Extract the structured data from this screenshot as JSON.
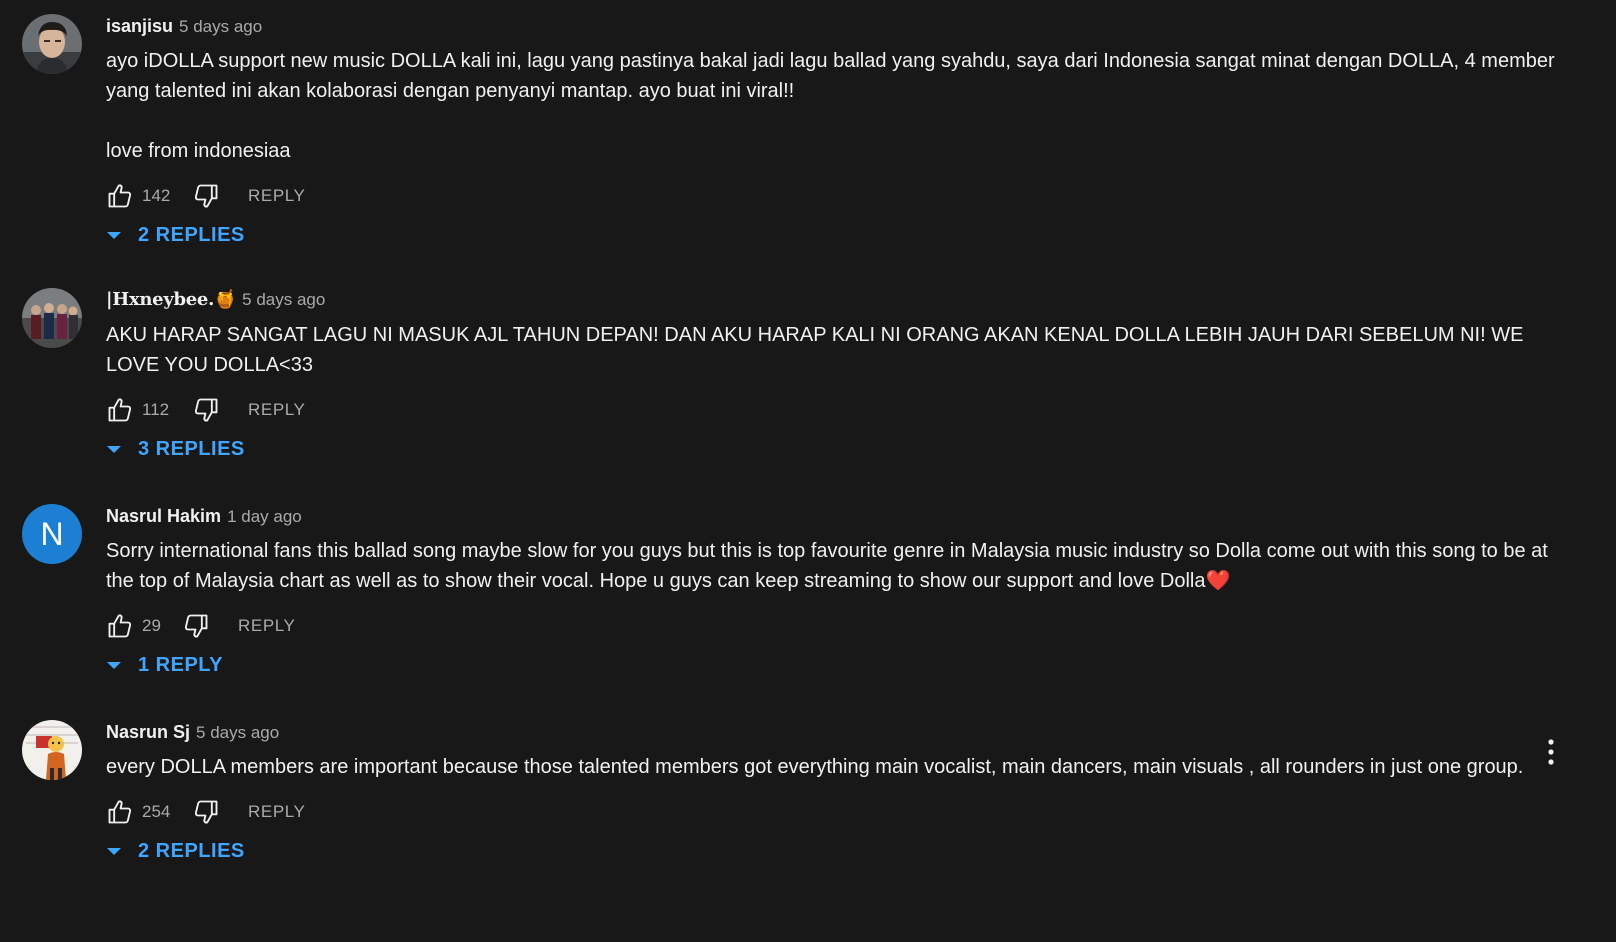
{
  "comments": [
    {
      "author": "isanjisu",
      "time": "5 days ago",
      "text": "ayo iDOLLA support new music DOLLA kali ini, lagu yang pastinya bakal jadi lagu ballad yang syahdu, saya dari Indonesia sangat minat dengan DOLLA, 4 member yang talented ini akan kolaborasi dengan penyanyi mantap. ayo buat ini viral!!\n\nlove from indonesiaa",
      "likes": "142",
      "reply_label": "REPLY",
      "replies_label": "2 REPLIES",
      "avatar": "photo-man"
    },
    {
      "author": "|Hxneybee.🍯",
      "time": "5 days ago",
      "text": "AKU HARAP SANGAT LAGU NI MASUK AJL TAHUN DEPAN! DAN AKU HARAP KALI NI ORANG AKAN KENAL DOLLA LEBIH JAUH DARI SEBELUM NI! WE LOVE YOU DOLLA<33",
      "likes": "112",
      "reply_label": "REPLY",
      "replies_label": "3 REPLIES",
      "avatar": "photo-group"
    },
    {
      "author": "Nasrul Hakim",
      "time": "1 day ago",
      "text": "Sorry international fans this ballad song maybe slow for you guys but this is top favourite genre in Malaysia music industry so Dolla come out with this song to be at the top of Malaysia chart as well as to show their vocal. Hope u guys can keep streaming to show our support and love Dolla❤️",
      "likes": "29",
      "reply_label": "REPLY",
      "replies_label": "1 REPLY",
      "avatar_letter": "N",
      "avatar_color": "#1c7fd4"
    },
    {
      "author": "Nasrun Sj",
      "time": "5 days ago",
      "text": "every DOLLA members are important because those talented members got everything main vocalist, main dancers, main visuals , all rounders in just one group.",
      "likes": "254",
      "reply_label": "REPLY",
      "replies_label": "2 REPLIES",
      "avatar": "photo-cartoon"
    }
  ],
  "colors": {
    "background": "#181818",
    "link": "#3ea6ff",
    "secondary_text": "#aaaaaa"
  },
  "icons": [
    "thumb-up-icon",
    "thumb-down-icon",
    "caret-down-icon",
    "more-vert-icon"
  ]
}
